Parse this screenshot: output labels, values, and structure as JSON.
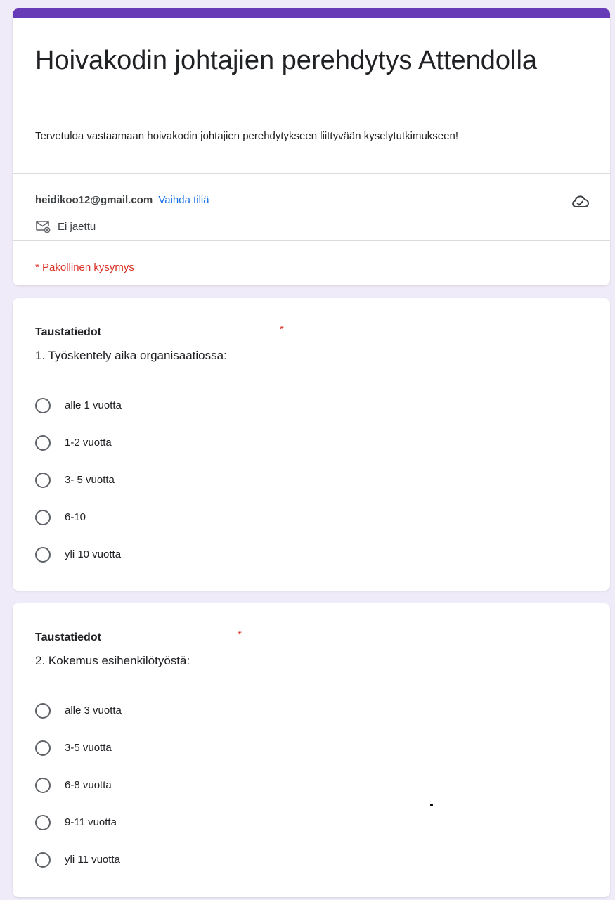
{
  "header": {
    "title": "Hoivakodin johtajien perehdytys Attendolla",
    "description": "Tervetuloa vastaamaan hoivakodin johtajien perehdytykseen liittyvään kyselytutkimukseen!",
    "accent_color": "#673ab7"
  },
  "account": {
    "email": "heidikoo12@gmail.com",
    "switch_label": "Vaihda tiliä",
    "sharing_status": "Ei jaettu",
    "cloud_icon": "cloud-check-icon"
  },
  "required_note": "* Pakollinen kysymys",
  "questions": [
    {
      "section": "Taustatiedot",
      "asterisk": "*",
      "text": "1. Työskentely aika organisaatiossa:",
      "options": [
        "alle 1 vuotta",
        "1-2 vuotta",
        "3- 5 vuotta",
        "6-10",
        "yli 10 vuotta"
      ]
    },
    {
      "section": "Taustatiedot",
      "asterisk": "*",
      "text": "2. Kokemus esihenkilötyöstä:",
      "options": [
        "alle 3 vuotta",
        "3-5 vuotta",
        "6-8 vuotta",
        "9-11 vuotta",
        "yli 11 vuotta"
      ]
    }
  ]
}
